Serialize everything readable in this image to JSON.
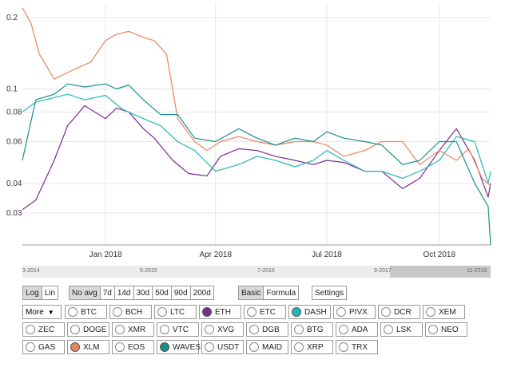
{
  "chart_data": {
    "type": "line",
    "yscale": "log",
    "ylim": [
      0.022,
      0.23
    ],
    "xlim": [
      "2017-10-25",
      "2018-11-12"
    ],
    "y_ticks": [
      {
        "value": 0.03,
        "label": "0.03"
      },
      {
        "value": 0.04,
        "label": "0.04"
      },
      {
        "value": 0.06,
        "label": "0.06"
      },
      {
        "value": 0.08,
        "label": "0.08"
      },
      {
        "value": 0.1,
        "label": "0.1"
      },
      {
        "value": 0.2,
        "label": "0.2"
      }
    ],
    "x_ticks": [
      {
        "value": "2018-01-01",
        "label": "Jan 2018"
      },
      {
        "value": "2018-04-01",
        "label": "Apr 2018"
      },
      {
        "value": "2018-07-01",
        "label": "Jul 2018"
      },
      {
        "value": "2018-10-01",
        "label": "Oct 2018"
      }
    ],
    "grid": true,
    "series": [
      {
        "name": "ETH",
        "color": "#7b2a92",
        "x": [
          "2017-10-25",
          "2017-11-05",
          "2017-11-20",
          "2017-12-01",
          "2017-12-15",
          "2018-01-01",
          "2018-01-10",
          "2018-01-20",
          "2018-02-01",
          "2018-02-10",
          "2018-02-25",
          "2018-03-10",
          "2018-03-25",
          "2018-04-05",
          "2018-04-20",
          "2018-05-05",
          "2018-05-20",
          "2018-06-05",
          "2018-06-20",
          "2018-07-01",
          "2018-07-15",
          "2018-08-01",
          "2018-08-15",
          "2018-09-01",
          "2018-09-15",
          "2018-10-01",
          "2018-10-15",
          "2018-10-30",
          "2018-11-10",
          "2018-11-12"
        ],
        "y": [
          0.031,
          0.034,
          0.05,
          0.07,
          0.085,
          0.075,
          0.083,
          0.08,
          0.068,
          0.062,
          0.05,
          0.044,
          0.043,
          0.052,
          0.056,
          0.055,
          0.052,
          0.05,
          0.048,
          0.05,
          0.049,
          0.045,
          0.045,
          0.038,
          0.042,
          0.055,
          0.068,
          0.05,
          0.035,
          0.04
        ]
      },
      {
        "name": "DASH",
        "color": "#25b7b5",
        "x": [
          "2017-10-25",
          "2017-11-05",
          "2017-11-20",
          "2017-12-01",
          "2017-12-15",
          "2018-01-01",
          "2018-01-15",
          "2018-02-01",
          "2018-02-15",
          "2018-03-01",
          "2018-03-15",
          "2018-04-01",
          "2018-04-20",
          "2018-05-05",
          "2018-05-20",
          "2018-06-05",
          "2018-06-20",
          "2018-07-01",
          "2018-07-15",
          "2018-08-01",
          "2018-08-15",
          "2018-09-01",
          "2018-09-15",
          "2018-10-01",
          "2018-10-15",
          "2018-10-30",
          "2018-11-10",
          "2018-11-12"
        ],
        "y": [
          0.08,
          0.088,
          0.092,
          0.095,
          0.09,
          0.094,
          0.082,
          0.075,
          0.07,
          0.06,
          0.055,
          0.045,
          0.048,
          0.052,
          0.05,
          0.047,
          0.05,
          0.055,
          0.05,
          0.045,
          0.045,
          0.042,
          0.045,
          0.05,
          0.063,
          0.06,
          0.04,
          0.045
        ]
      },
      {
        "name": "XLM",
        "color": "#e8845a",
        "x": [
          "2017-10-25",
          "2017-11-01",
          "2017-11-08",
          "2017-11-20",
          "2017-12-05",
          "2017-12-20",
          "2018-01-01",
          "2018-01-10",
          "2018-01-20",
          "2018-02-01",
          "2018-02-10",
          "2018-02-20",
          "2018-03-01",
          "2018-03-15",
          "2018-03-25",
          "2018-04-05",
          "2018-04-20",
          "2018-05-05",
          "2018-05-20",
          "2018-06-05",
          "2018-06-20",
          "2018-07-01",
          "2018-07-15",
          "2018-08-01",
          "2018-08-15",
          "2018-09-01",
          "2018-09-15",
          "2018-10-01",
          "2018-10-15",
          "2018-10-25",
          "2018-11-05",
          "2018-11-12"
        ],
        "y": [
          0.22,
          0.19,
          0.14,
          0.11,
          0.12,
          0.13,
          0.16,
          0.17,
          0.175,
          0.165,
          0.16,
          0.14,
          0.075,
          0.06,
          0.055,
          0.06,
          0.063,
          0.06,
          0.058,
          0.06,
          0.06,
          0.058,
          0.052,
          0.055,
          0.06,
          0.06,
          0.048,
          0.055,
          0.05,
          0.056,
          0.042,
          0.039
        ]
      },
      {
        "name": "WAVES",
        "color": "#1a8f8a",
        "x": [
          "2017-10-25",
          "2017-11-05",
          "2017-11-20",
          "2017-12-01",
          "2017-12-15",
          "2018-01-01",
          "2018-01-10",
          "2018-01-20",
          "2018-02-01",
          "2018-02-15",
          "2018-03-01",
          "2018-03-15",
          "2018-04-01",
          "2018-04-20",
          "2018-05-05",
          "2018-05-20",
          "2018-06-05",
          "2018-06-20",
          "2018-07-01",
          "2018-07-15",
          "2018-08-01",
          "2018-08-15",
          "2018-09-01",
          "2018-09-15",
          "2018-10-01",
          "2018-10-15",
          "2018-10-30",
          "2018-11-10",
          "2018-11-12"
        ],
        "y": [
          0.05,
          0.09,
          0.095,
          0.105,
          0.102,
          0.105,
          0.1,
          0.104,
          0.09,
          0.078,
          0.078,
          0.062,
          0.06,
          0.068,
          0.062,
          0.058,
          0.062,
          0.06,
          0.066,
          0.062,
          0.06,
          0.058,
          0.048,
          0.05,
          0.06,
          0.06,
          0.04,
          0.032,
          0.022
        ]
      }
    ]
  },
  "navigator": {
    "labels": [
      "3-2014",
      "5-2015",
      "7-2016",
      "9-2017",
      "11-2018"
    ]
  },
  "scale_toggle": {
    "log": "Log",
    "lin": "Lin"
  },
  "averages": [
    "No avg",
    "7d",
    "14d",
    "30d",
    "50d",
    "90d",
    "200d"
  ],
  "modes": [
    "Basic",
    "Formula"
  ],
  "settings_label": "Settings",
  "more_label": "More",
  "coins": [
    {
      "label": "BTC",
      "on": false,
      "color": ""
    },
    {
      "label": "BCH",
      "on": false,
      "color": ""
    },
    {
      "label": "LTC",
      "on": false,
      "color": ""
    },
    {
      "label": "ETH",
      "on": true,
      "color": "#7b2a92"
    },
    {
      "label": "ETC",
      "on": false,
      "color": ""
    },
    {
      "label": "DASH",
      "on": true,
      "color": "#25b7b5"
    },
    {
      "label": "PIVX",
      "on": false,
      "color": ""
    },
    {
      "label": "DCR",
      "on": false,
      "color": ""
    },
    {
      "label": "XEM",
      "on": false,
      "color": ""
    },
    {
      "label": "ZEC",
      "on": false,
      "color": ""
    },
    {
      "label": "DOGE",
      "on": false,
      "color": ""
    },
    {
      "label": "XMR",
      "on": false,
      "color": ""
    },
    {
      "label": "VTC",
      "on": false,
      "color": ""
    },
    {
      "label": "XVG",
      "on": false,
      "color": ""
    },
    {
      "label": "DGB",
      "on": false,
      "color": ""
    },
    {
      "label": "BTG",
      "on": false,
      "color": ""
    },
    {
      "label": "ADA",
      "on": false,
      "color": ""
    },
    {
      "label": "LSK",
      "on": false,
      "color": ""
    },
    {
      "label": "NEO",
      "on": false,
      "color": ""
    },
    {
      "label": "GAS",
      "on": false,
      "color": ""
    },
    {
      "label": "XLM",
      "on": true,
      "color": "#e8845a"
    },
    {
      "label": "EOS",
      "on": false,
      "color": ""
    },
    {
      "label": "WAVES",
      "on": true,
      "color": "#1a8f8a"
    },
    {
      "label": "USDT",
      "on": false,
      "color": ""
    },
    {
      "label": "MAID",
      "on": false,
      "color": ""
    },
    {
      "label": "XRP",
      "on": false,
      "color": ""
    },
    {
      "label": "TRX",
      "on": false,
      "color": ""
    }
  ]
}
